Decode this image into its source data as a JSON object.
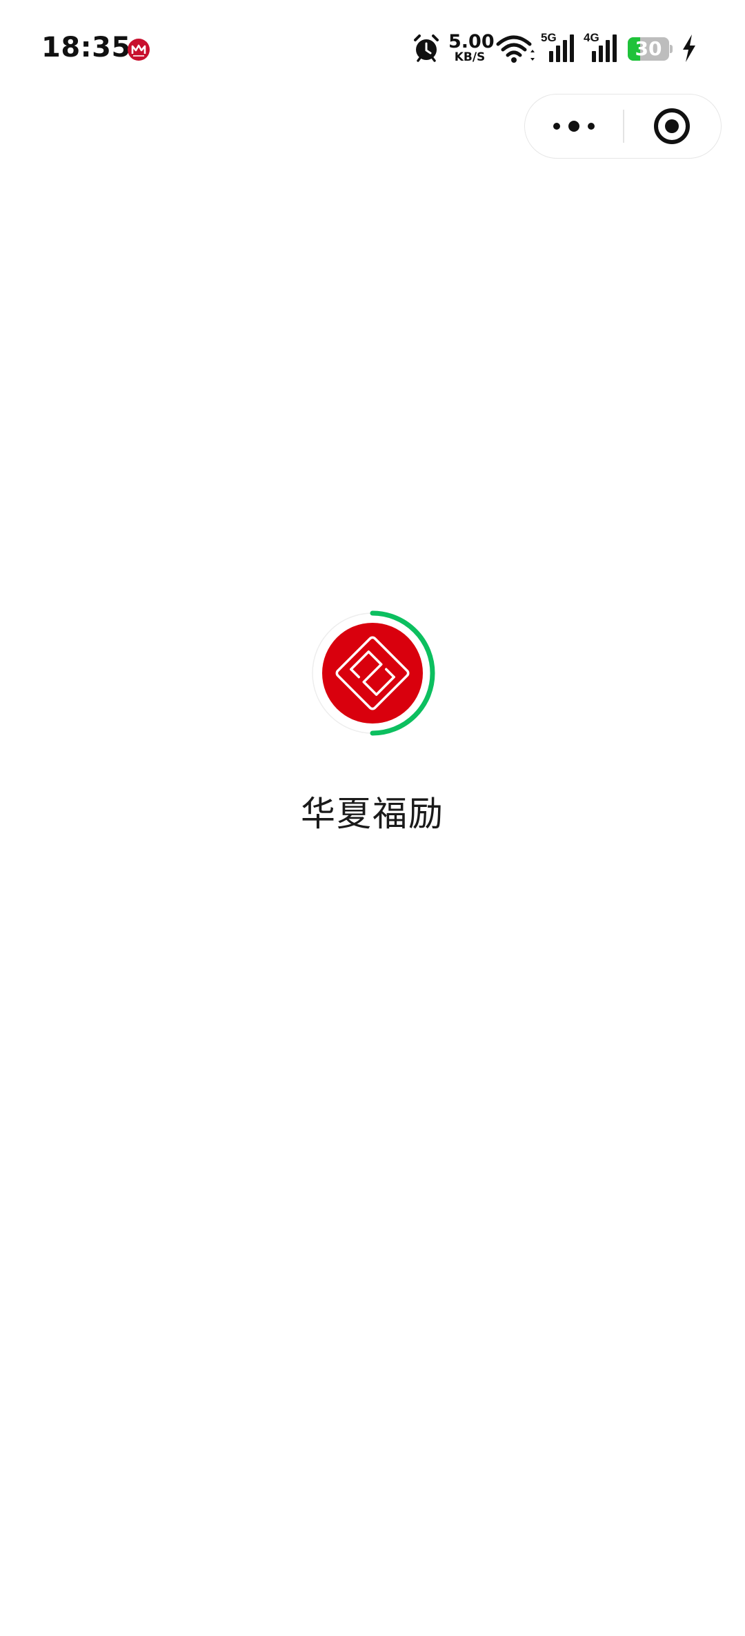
{
  "status_bar": {
    "time": "18:35",
    "network_speed_value": "5.00",
    "network_speed_unit": "KB/S",
    "signal_1_label": "5G",
    "signal_2_label": "4G",
    "battery_level": "30",
    "battery_fraction": 0.3,
    "icons": [
      "cmb-bank-icon",
      "alarm-icon",
      "wifi-icon",
      "signal-5g-icon",
      "signal-4g-icon",
      "battery-icon",
      "charging-icon"
    ]
  },
  "capsule": {
    "icons": [
      "more-dots-icon",
      "close-target-icon"
    ]
  },
  "splash": {
    "app_name": "华夏福励",
    "loading_progress": 0.5
  },
  "colors": {
    "background": "#ffffff",
    "logo_red": "#d9000d",
    "loader_green": "#0cbf5f",
    "battery_green": "#1fc23a",
    "text": "#1a1a1a"
  }
}
